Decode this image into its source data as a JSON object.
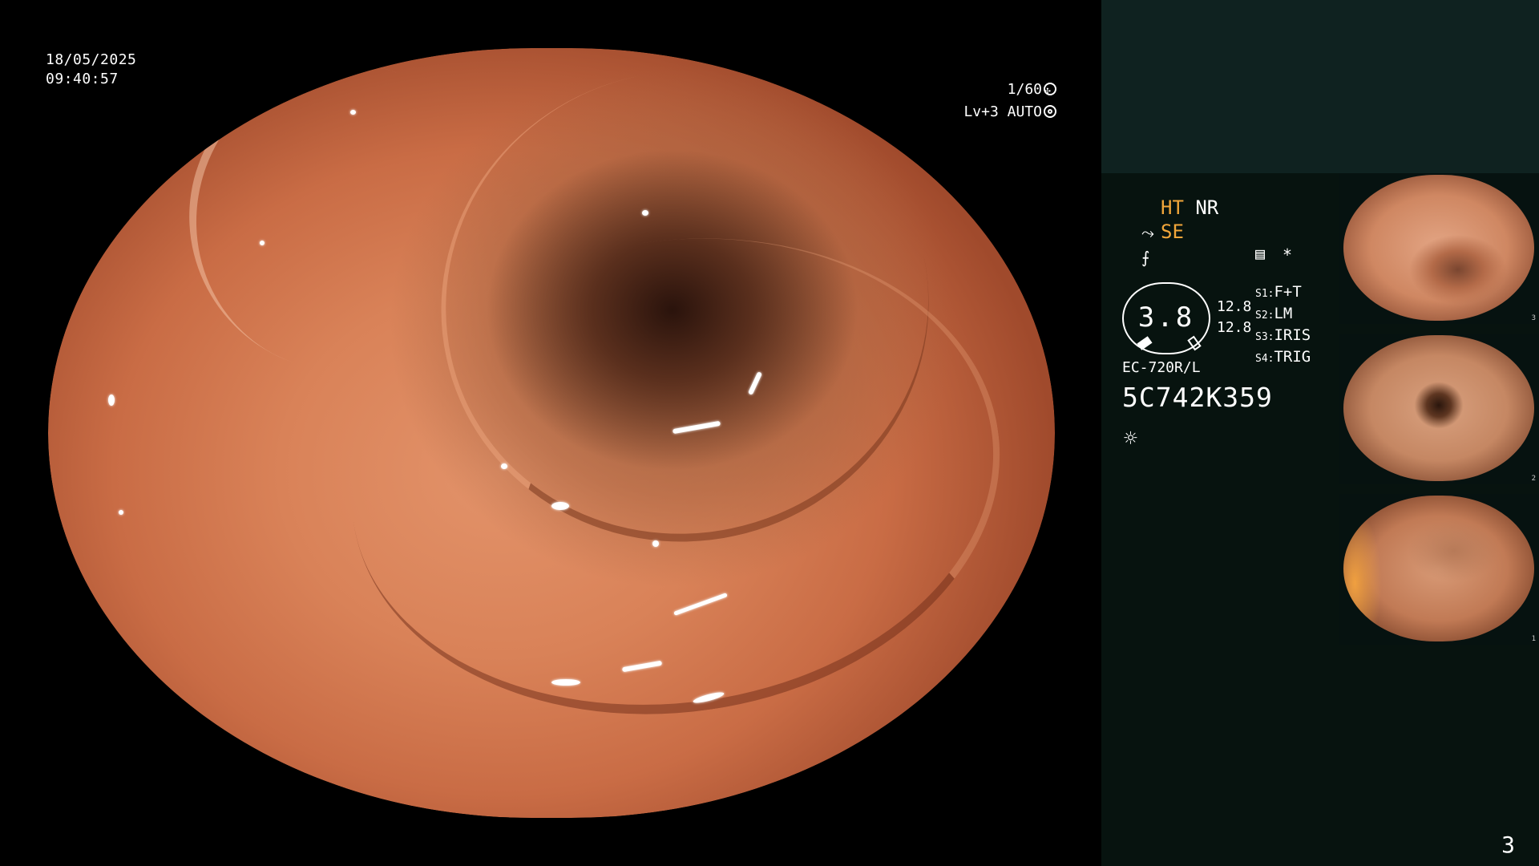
{
  "overlay": {
    "date": "18/05/2025",
    "time": "09:40:57",
    "shutter": "1/60",
    "level": "Lv+3 AUTO"
  },
  "panel": {
    "status_ht": "HT",
    "status_nr": "NR",
    "status_se": "SE",
    "gauge_value": "3.8",
    "gauge_side_1": "12.8",
    "gauge_side_2": "12.8",
    "switches": [
      {
        "key": "S1:",
        "value": "F+T"
      },
      {
        "key": "S2:",
        "value": "LM"
      },
      {
        "key": "S3:",
        "value": "IRIS"
      },
      {
        "key": "S4:",
        "value": "TRIG"
      }
    ],
    "scope_model": "EC-720R/L",
    "serial": "5C742K359",
    "star": "*"
  },
  "thumbnails": [
    {
      "num": "3"
    },
    {
      "num": "2"
    },
    {
      "num": "1"
    }
  ],
  "page_number": "3",
  "colors": {
    "accent_orange": "#f2a63a",
    "panel_bg": "#07130f",
    "panel_top_bg": "#0f2220"
  }
}
